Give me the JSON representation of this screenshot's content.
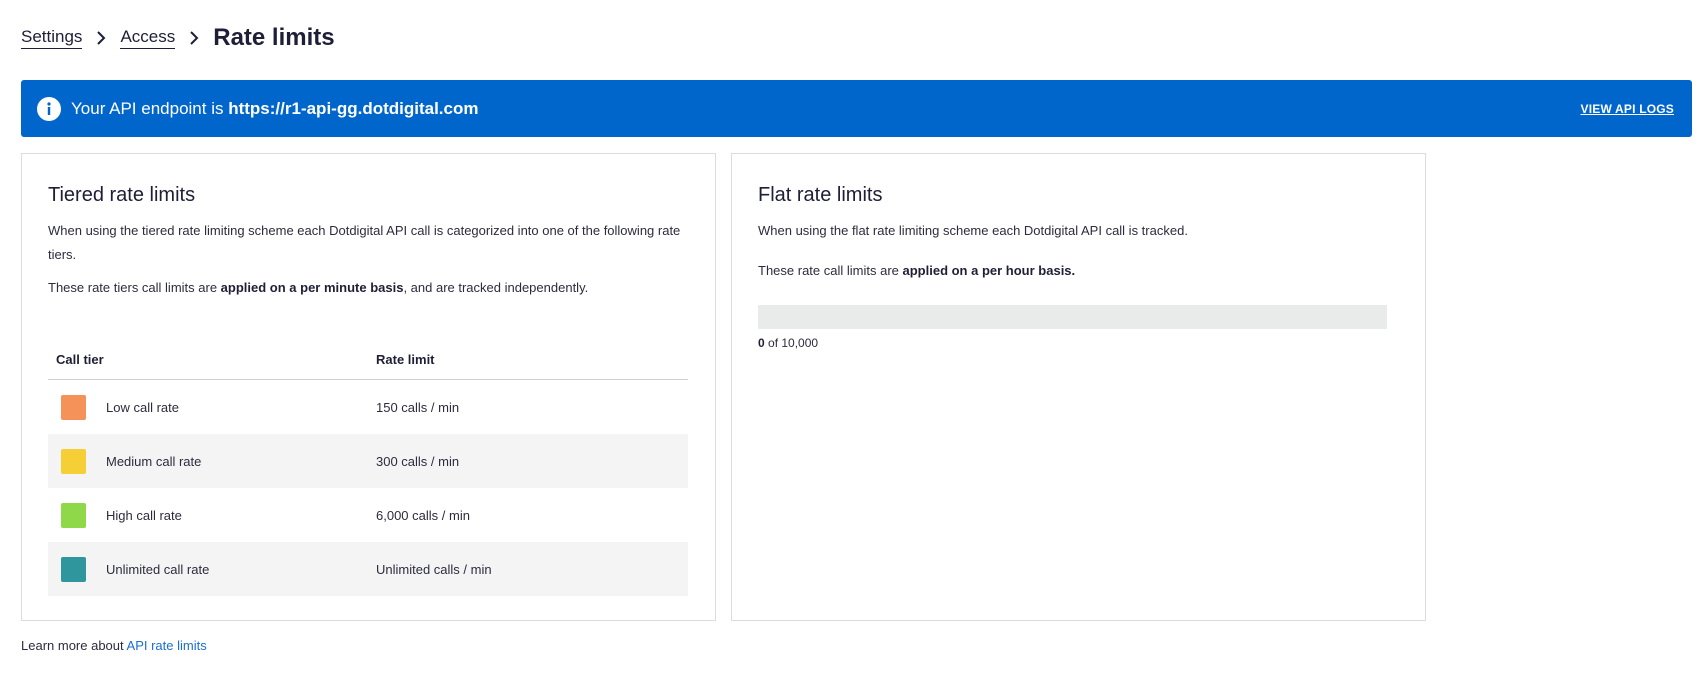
{
  "breadcrumb": {
    "items": [
      "Settings",
      "Access"
    ],
    "current": "Rate limits"
  },
  "banner": {
    "prefix": "Your API endpoint is ",
    "endpoint": "https://r1-api-gg.dotdigital.com",
    "link_label": "VIEW API LOGS",
    "color": "#0066cc"
  },
  "tiered": {
    "title": "Tiered rate limits",
    "description": "When using the tiered rate limiting scheme each Dotdigital API call is categorized into one of the following rate tiers.",
    "basis_prefix": "These rate tiers call limits are ",
    "basis_bold": "applied on a per minute basis",
    "basis_suffix": ", and are tracked independently.",
    "columns": [
      "Call tier",
      "Rate limit"
    ],
    "rows": [
      {
        "label": "Low call rate",
        "limit": "150 calls / min",
        "color": "#f5925a"
      },
      {
        "label": "Medium call rate",
        "limit": "300 calls / min",
        "color": "#f6cf37"
      },
      {
        "label": "High call rate",
        "limit": "6,000 calls / min",
        "color": "#8fd84a"
      },
      {
        "label": "Unlimited call rate",
        "limit": "Unlimited calls / min",
        "color": "#2f969e"
      }
    ]
  },
  "flat": {
    "title": "Flat rate limits",
    "description": "When using the flat rate limiting scheme each Dotdigital API call is tracked.",
    "basis_prefix": "These rate call limits are ",
    "basis_bold": "applied on a per hour basis.",
    "used": "0",
    "of_text": " of ",
    "total": "10,000",
    "progress_fraction": 0
  },
  "footer": {
    "prefix": "Learn more about ",
    "link_label": "API rate limits"
  }
}
